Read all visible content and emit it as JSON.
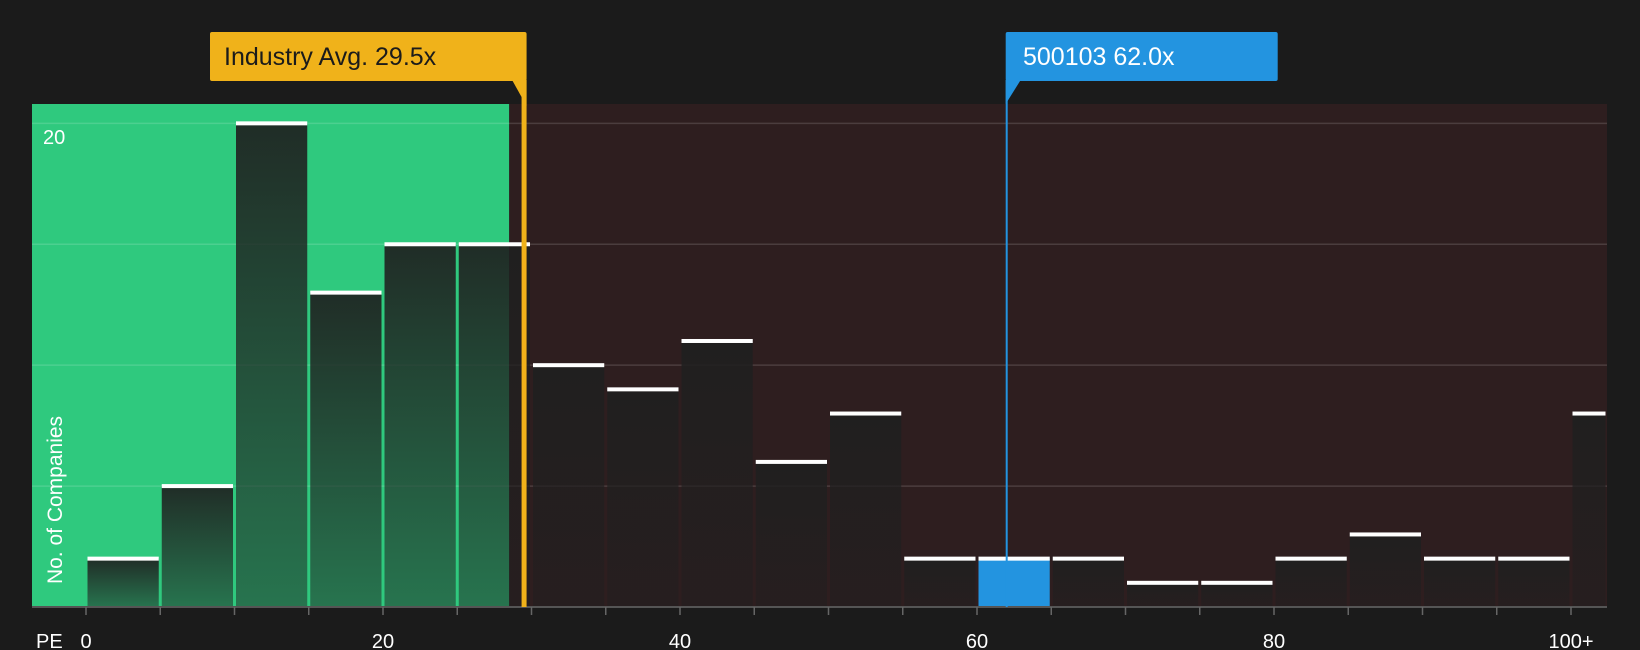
{
  "chart_data": {
    "type": "bar",
    "xlabel": "PE",
    "ylabel": "No. of Companies",
    "y_tick_label": "20",
    "xlim": [
      -5,
      102
    ],
    "ylim": [
      0,
      20.8
    ],
    "grid": true,
    "x_ticks": [
      {
        "value": 0,
        "label": "0"
      },
      {
        "value": 20,
        "label": "20"
      },
      {
        "value": 40,
        "label": "40"
      },
      {
        "value": 60,
        "label": "60"
      },
      {
        "value": 80,
        "label": "80"
      },
      {
        "value": 100,
        "label": "100+"
      }
    ],
    "bins": [
      {
        "start": 0,
        "end": 5,
        "count": 2
      },
      {
        "start": 5,
        "end": 10,
        "count": 5
      },
      {
        "start": 10,
        "end": 15,
        "count": 20
      },
      {
        "start": 15,
        "end": 20,
        "count": 13
      },
      {
        "start": 20,
        "end": 25,
        "count": 15
      },
      {
        "start": 25,
        "end": 30,
        "count": 15
      },
      {
        "start": 30,
        "end": 35,
        "count": 10
      },
      {
        "start": 35,
        "end": 40,
        "count": 9
      },
      {
        "start": 40,
        "end": 45,
        "count": 11
      },
      {
        "start": 45,
        "end": 50,
        "count": 6
      },
      {
        "start": 50,
        "end": 55,
        "count": 8
      },
      {
        "start": 55,
        "end": 60,
        "count": 2
      },
      {
        "start": 60,
        "end": 65,
        "count": 2,
        "highlight": true
      },
      {
        "start": 65,
        "end": 70,
        "count": 2
      },
      {
        "start": 70,
        "end": 75,
        "count": 1
      },
      {
        "start": 75,
        "end": 80,
        "count": 1
      },
      {
        "start": 80,
        "end": 85,
        "count": 2
      },
      {
        "start": 85,
        "end": 90,
        "count": 3
      },
      {
        "start": 90,
        "end": 95,
        "count": 2
      },
      {
        "start": 95,
        "end": 100,
        "count": 2
      },
      {
        "start": 100,
        "end": 102.6,
        "count": 8
      }
    ],
    "industry_avg": {
      "value": 29.5,
      "label": "Industry Avg. 29.5x"
    },
    "company": {
      "value": 62.0,
      "label": "500103 62.0x"
    },
    "colors": {
      "background": "#1b1b1b",
      "below_avg_region": "#2fc97e",
      "above_avg_region": "#2e1e1f",
      "industry_avg": "#f0b21a",
      "company": "#2394e0",
      "bar_cap": "#ffffff",
      "text": "#ffffff"
    }
  }
}
